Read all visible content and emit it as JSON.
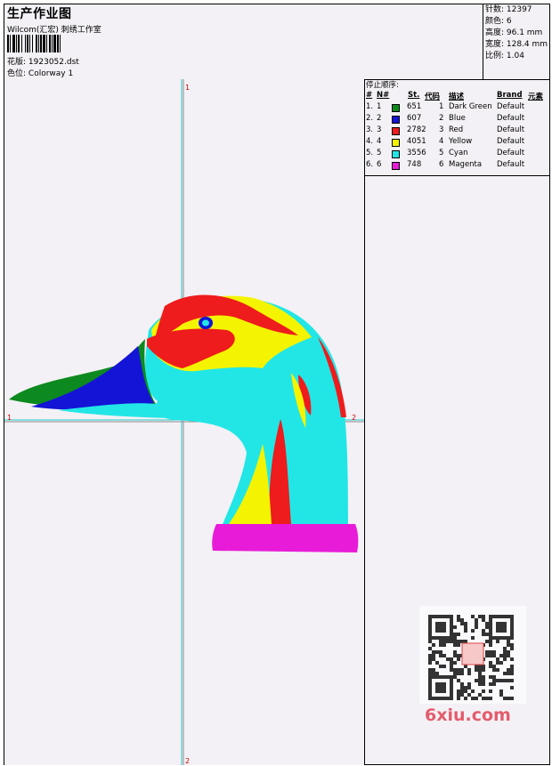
{
  "header": {
    "title": "生产作业图",
    "subtitle": "Wilcom(汇宏) 刺绣工作室",
    "design_label": "花版:",
    "design_value": "1923052.dst",
    "colorway_label": "色位:",
    "colorway_value": "Colorway 1"
  },
  "stats": {
    "stitches": "针数: 12397",
    "colors": "颜色: 6",
    "height": "高度: 96.1 mm",
    "width": "宽度: 128.4 mm",
    "scale": "比例: 1.04"
  },
  "sequence": {
    "title": "停止顺序:",
    "headers": [
      "#",
      "N#",
      "St.",
      "代码",
      "描述",
      "Brand",
      "元素"
    ],
    "rows": [
      {
        "idx": "1.",
        "n": "1",
        "color": "#0d8a1f",
        "st": "651",
        "code": "1",
        "desc": "Dark Green",
        "brand": "Default"
      },
      {
        "idx": "2.",
        "n": "2",
        "color": "#1414d6",
        "st": "607",
        "code": "2",
        "desc": "Blue",
        "brand": "Default"
      },
      {
        "idx": "3.",
        "n": "3",
        "color": "#ee1c1c",
        "st": "2782",
        "code": "3",
        "desc": "Red",
        "brand": "Default"
      },
      {
        "idx": "4.",
        "n": "4",
        "color": "#f4f400",
        "st": "4051",
        "code": "4",
        "desc": "Yellow",
        "brand": "Default"
      },
      {
        "idx": "5.",
        "n": "5",
        "color": "#22e6e6",
        "st": "3556",
        "code": "5",
        "desc": "Cyan",
        "brand": "Default"
      },
      {
        "idx": "6.",
        "n": "6",
        "color": "#e81cd8",
        "st": "748",
        "code": "6",
        "desc": "Magenta",
        "brand": "Default"
      }
    ]
  },
  "axes": {
    "top_marker": "1",
    "bottom_marker": "2",
    "left_marker": "1",
    "right_marker": "2"
  },
  "watermark": {
    "text": "6xiu.com"
  }
}
